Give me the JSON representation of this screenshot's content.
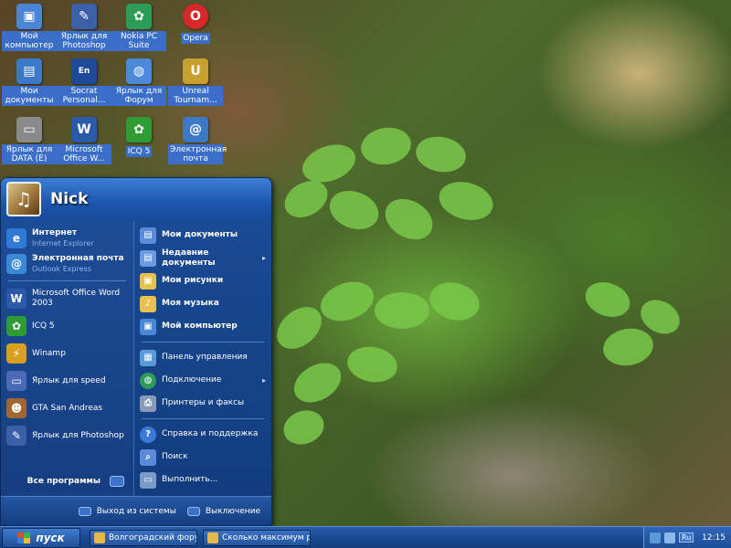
{
  "desktop": {
    "icons": [
      {
        "label": "Мой компьютер",
        "icon": "computer-icon",
        "color": "#4a86d8"
      },
      {
        "label": "Ярлык для Photoshop",
        "icon": "photoshop-icon",
        "color": "#3b5fa8"
      },
      {
        "label": "Nokia PC Suite",
        "icon": "nokia-icon",
        "color": "#2c9c58"
      },
      {
        "label": "Opera",
        "icon": "opera-icon",
        "color": "#d8282a"
      },
      {
        "label": "Мои документы",
        "icon": "documents-icon",
        "color": "#3b79c8"
      },
      {
        "label": "Socrat Personal...",
        "icon": "translator-icon",
        "color": "#1f4a9a"
      },
      {
        "label": "Ярлык для Форум",
        "icon": "forum-icon",
        "color": "#4a8ad8"
      },
      {
        "label": "Unreal Tournam...",
        "icon": "unreal-icon",
        "color": "#c8a030"
      },
      {
        "label": "Ярлык для DATA (E)",
        "icon": "drive-icon",
        "color": "#8a8a8a"
      },
      {
        "label": "Microsoft Office W...",
        "icon": "word-icon",
        "color": "#2a5aa8"
      },
      {
        "label": "ICQ 5",
        "icon": "icq-icon",
        "color": "#2e9c32"
      },
      {
        "label": "Электронная почта",
        "icon": "mail-icon",
        "color": "#3b79c8"
      }
    ]
  },
  "start_menu": {
    "user_name": "Nick",
    "left_pinned": [
      {
        "main": "Интернет",
        "sub": "Internet Explorer",
        "icon": "ie-icon",
        "color": "#2f7ad6",
        "glyph": "e"
      },
      {
        "main": "Электронная почта",
        "sub": "Outlook Express",
        "icon": "outlook-icon",
        "color": "#3b8ad8",
        "glyph": "@"
      }
    ],
    "left_recent": [
      {
        "main": "Microsoft Office Word 2003",
        "icon": "word-icon",
        "color": "#2a5aa8",
        "glyph": "W"
      },
      {
        "main": "ICQ 5",
        "icon": "icq-icon",
        "color": "#2e9c32",
        "glyph": "✿"
      },
      {
        "main": "Winamp",
        "icon": "winamp-icon",
        "color": "#d8a020",
        "glyph": "⚡"
      },
      {
        "main": "Ярлык для speed",
        "icon": "speed-icon",
        "color": "#4a6ab8",
        "glyph": "▭"
      },
      {
        "main": "GTA San Andreas",
        "icon": "gta-icon",
        "color": "#a06830",
        "glyph": "☻"
      },
      {
        "main": "Ярлык для Photoshop",
        "icon": "photoshop-icon",
        "color": "#3b5fa8",
        "glyph": "✎"
      }
    ],
    "all_programs": "Все программы",
    "right_group1": [
      {
        "main": "Мои документы",
        "icon": "documents-icon",
        "color": "#5a8ad8",
        "glyph": "▤"
      },
      {
        "main": "Недавние документы",
        "icon": "recent-docs-icon",
        "color": "#6a9ae0",
        "glyph": "▤",
        "arrow": "▸"
      },
      {
        "main": "Мои рисунки",
        "icon": "pictures-icon",
        "color": "#e8c050",
        "glyph": "▣"
      },
      {
        "main": "Моя музыка",
        "icon": "music-icon",
        "color": "#e8c050",
        "glyph": "♪"
      },
      {
        "main": "Мой компьютер",
        "icon": "computer-icon",
        "color": "#4a86d8",
        "glyph": "▣"
      }
    ],
    "right_group2": [
      {
        "main": "Панель управления",
        "icon": "control-panel-icon",
        "color": "#5a9ad8",
        "glyph": "▦"
      },
      {
        "main": "Подключение",
        "icon": "network-icon",
        "color": "#2e9c58",
        "glyph": "◍",
        "arrow": "▸"
      },
      {
        "main": "Принтеры и факсы",
        "icon": "printer-icon",
        "color": "#8a9ab8",
        "glyph": "⎙"
      }
    ],
    "right_group3": [
      {
        "main": "Справка и поддержка",
        "icon": "help-icon",
        "color": "#3b79d8",
        "glyph": "?"
      },
      {
        "main": "Поиск",
        "icon": "search-icon",
        "color": "#5a8ad8",
        "glyph": "⌕"
      },
      {
        "main": "Выполнить...",
        "icon": "run-icon",
        "color": "#7a9ac8",
        "glyph": "▭"
      }
    ],
    "logoff_label": "Выход из системы",
    "shutdown_label": "Выключение"
  },
  "taskbar": {
    "start_label": "пуск",
    "tasks": [
      {
        "label": "Волгоградский фору..."
      },
      {
        "label": "Сколько максимум ра..."
      }
    ],
    "tray": {
      "lang": "Ru",
      "clock": "12:15"
    }
  }
}
